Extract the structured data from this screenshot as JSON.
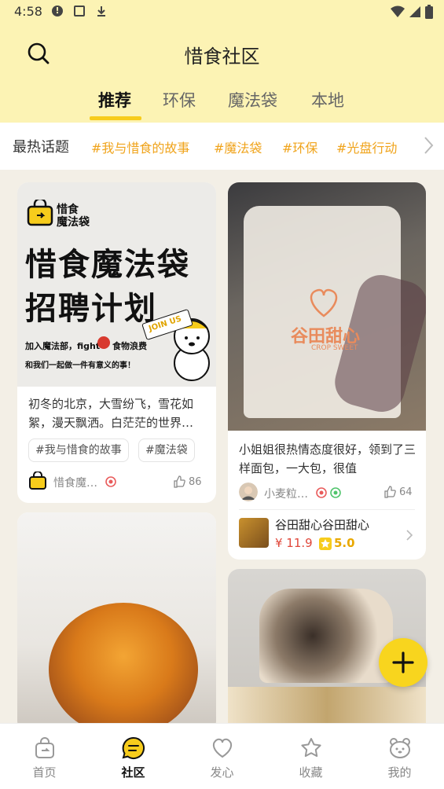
{
  "status_bar": {
    "time": "4:58"
  },
  "header": {
    "title": "惜食社区"
  },
  "tabs": [
    {
      "label": "推荐",
      "active": true
    },
    {
      "label": "环保"
    },
    {
      "label": "魔法袋"
    },
    {
      "label": "本地"
    }
  ],
  "topics": {
    "label": "最热话题",
    "tags": [
      "#我与惜食的故事",
      "#魔法袋",
      "#环保",
      "#光盘行动"
    ]
  },
  "cards": {
    "promo": {
      "logo_line1": "惜食",
      "logo_line2": "魔法袋",
      "headline1": "惜食魔法袋",
      "headline2": "招聘计划",
      "join_us": "JOIN US",
      "slogan1_a": "加入魔法部，fight",
      "slogan1_b": "食物浪费",
      "slogan2": "和我们一起做一件有意义的事！",
      "text": "初冬的北京，大雪纷飞，雪花如絮，漫天飘洒。白茫茫的世界…",
      "chips": [
        "#我与惜食的故事",
        "#魔法袋"
      ],
      "author": "惜食魔…",
      "likes": "86"
    },
    "bag": {
      "bag_brand": "谷田甜心",
      "bag_sub": "CROP SWEET",
      "text": "小姐姐很热情态度很好，领到了三样面包，一大包，很值",
      "author": "小麦粒…",
      "likes": "64",
      "product": {
        "name": "谷田甜心谷田甜心",
        "price": "¥ 11.9",
        "rating": "5.0"
      }
    }
  },
  "fab": {
    "icon": "plus-icon"
  },
  "bottom_nav": [
    {
      "label": "首页",
      "icon": "bag-home-icon"
    },
    {
      "label": "社区",
      "icon": "chat-bubble-icon",
      "active": true
    },
    {
      "label": "发心",
      "icon": "heart-icon"
    },
    {
      "label": "收藏",
      "icon": "star-icon"
    },
    {
      "label": "我的",
      "icon": "bear-face-icon"
    }
  ],
  "colors": {
    "header_bg": "#fcf3b4",
    "accent_yellow": "#f7cc1c",
    "topic_orange": "#f0a41c",
    "price_red": "#e0473a"
  }
}
